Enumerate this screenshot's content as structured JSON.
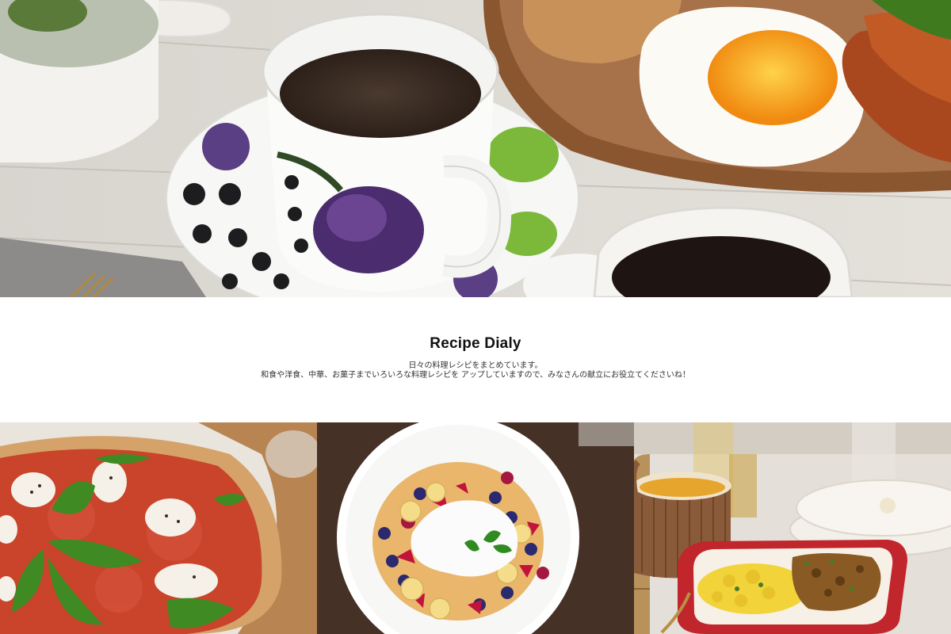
{
  "site": {
    "title": "Recipe Dialy",
    "description_lines": [
      "日々の料理レシピをまとめています。",
      "和食や洋食、中華、お菓子までいろいろな料理レシピを アップしていますので、みなさんの献立にお役立てくださいね！"
    ]
  },
  "hero": {
    "icon": "breakfast-coffee-photo"
  },
  "tiles": [
    {
      "icon": "pizza-photo"
    },
    {
      "icon": "pancake-photo"
    },
    {
      "icon": "curry-soup-photo"
    }
  ]
}
